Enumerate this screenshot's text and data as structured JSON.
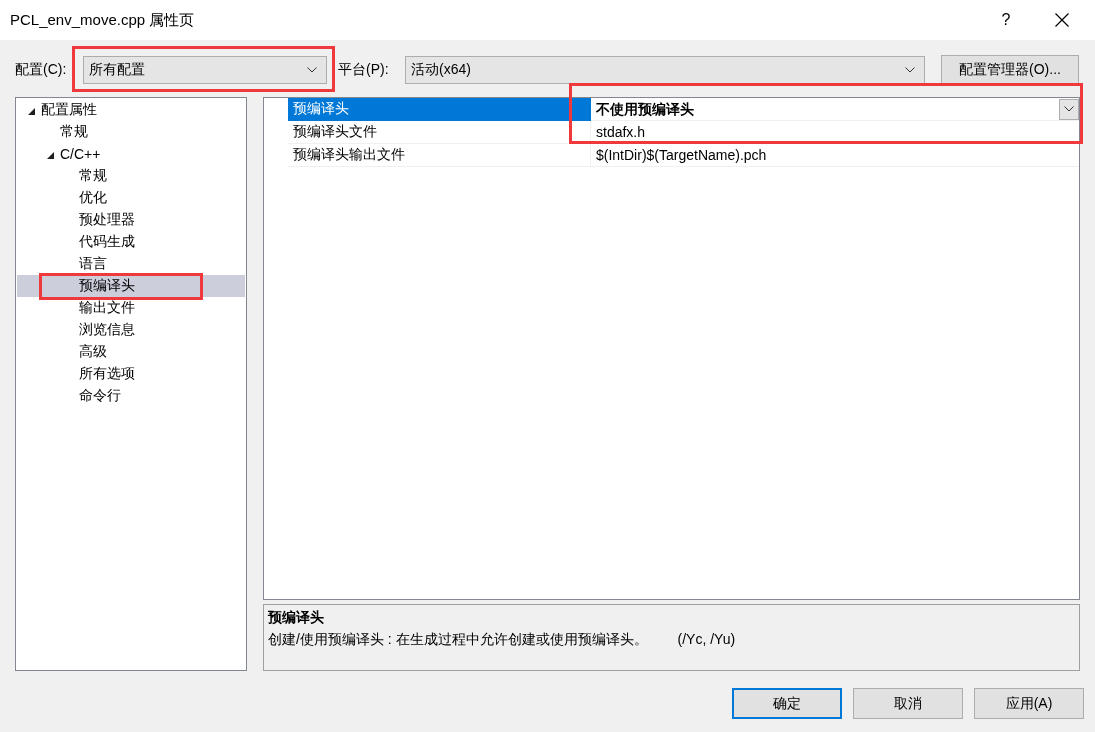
{
  "window": {
    "title": "PCL_env_move.cpp 属性页",
    "help_button": "?"
  },
  "config_bar": {
    "fields": [
      {
        "label": "配置(C):",
        "value": "所有配置",
        "highlighted": true
      },
      {
        "label": "平台(P):",
        "value": "活动(x64)",
        "highlighted": false
      }
    ],
    "manager_button": "配置管理器(O)..."
  },
  "tree": [
    {
      "label": "配置属性",
      "expanded": true,
      "selected": false,
      "highlighted": false,
      "children": [
        {
          "label": "常规",
          "selected": false,
          "highlighted": false
        },
        {
          "label": "C/C++",
          "expanded": true,
          "selected": false,
          "highlighted": false,
          "children": [
            {
              "label": "常规",
              "selected": false,
              "highlighted": false
            },
            {
              "label": "优化",
              "selected": false,
              "highlighted": false
            },
            {
              "label": "预处理器",
              "selected": false,
              "highlighted": false
            },
            {
              "label": "代码生成",
              "selected": false,
              "highlighted": false
            },
            {
              "label": "语言",
              "selected": false,
              "highlighted": false
            },
            {
              "label": "预编译头",
              "selected": true,
              "highlighted": true
            },
            {
              "label": "输出文件",
              "selected": false,
              "highlighted": false
            },
            {
              "label": "浏览信息",
              "selected": false,
              "highlighted": false
            },
            {
              "label": "高级",
              "selected": false,
              "highlighted": false
            },
            {
              "label": "所有选项",
              "selected": false,
              "highlighted": false
            },
            {
              "label": "命令行",
              "selected": false,
              "highlighted": false
            }
          ]
        }
      ]
    }
  ],
  "properties": {
    "rows": [
      {
        "name": "预编译头",
        "value": "不使用预编译头",
        "selected": true,
        "bold": true,
        "highlighted": true
      },
      {
        "name": "预编译头文件",
        "value": "stdafx.h",
        "selected": false,
        "bold": false,
        "highlighted": true
      },
      {
        "name": "预编译头输出文件",
        "value": "$(IntDir)$(TargetName).pch",
        "selected": false,
        "bold": false,
        "highlighted": false
      }
    ]
  },
  "description": {
    "title": "预编译头",
    "text": "创建/使用预编译头 : 在生成过程中允许创建或使用预编译头。",
    "switches": "(/Yc, /Yu)"
  },
  "buttons": [
    {
      "label": "确定",
      "default": true
    },
    {
      "label": "取消",
      "default": false
    },
    {
      "label": "应用(A)",
      "default": false
    }
  ]
}
